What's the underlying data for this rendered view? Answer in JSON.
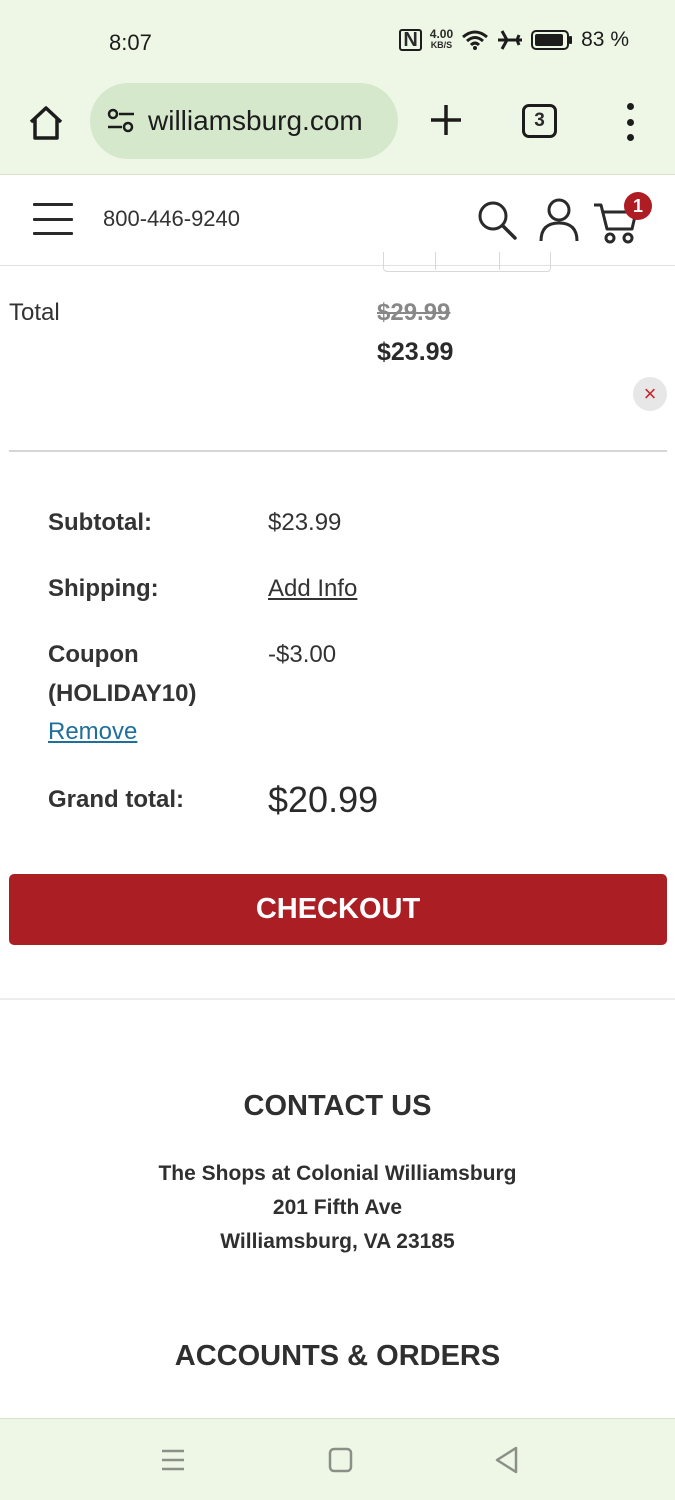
{
  "status_bar": {
    "time": "8:07",
    "nfc": "N",
    "net_speed": "4.00",
    "net_unit": "KB/S",
    "battery": "83 %"
  },
  "browser": {
    "url": "williamsburg.com",
    "tab_count": "3",
    "icons": [
      "home-icon",
      "site-settings-icon",
      "plus-icon",
      "tabs-icon",
      "more-vert-icon"
    ]
  },
  "header": {
    "phone": "800-446-9240",
    "cart_count": "1",
    "icons": [
      "menu-icon",
      "search-icon",
      "user-icon",
      "cart-icon"
    ]
  },
  "item": {
    "total_label": "Total",
    "original_price": "$29.99",
    "price": "$23.99",
    "remove_glyph": "×"
  },
  "summary": {
    "subtotal_label": "Subtotal:",
    "subtotal_value": "$23.99",
    "shipping_label": "Shipping:",
    "shipping_value": "Add Info",
    "coupon_label_line1": "Coupon",
    "coupon_label_line2": "(HOLIDAY10)",
    "coupon_value": "-$3.00",
    "remove_coupon": "Remove",
    "grand_total_label": "Grand total:",
    "grand_total_value": "$20.99"
  },
  "checkout": {
    "label": "CHECKOUT"
  },
  "footer": {
    "contact_title": "CONTACT US",
    "address_line1": "The Shops at Colonial Williamsburg",
    "address_line2": "201 Fifth Ave",
    "address_line3": "Williamsburg, VA 23185",
    "accounts_title": "ACCOUNTS & ORDERS"
  },
  "colors": {
    "accent": "#ab1f24",
    "link": "#1f6f9a",
    "browser_chrome": "#eef7e6"
  }
}
